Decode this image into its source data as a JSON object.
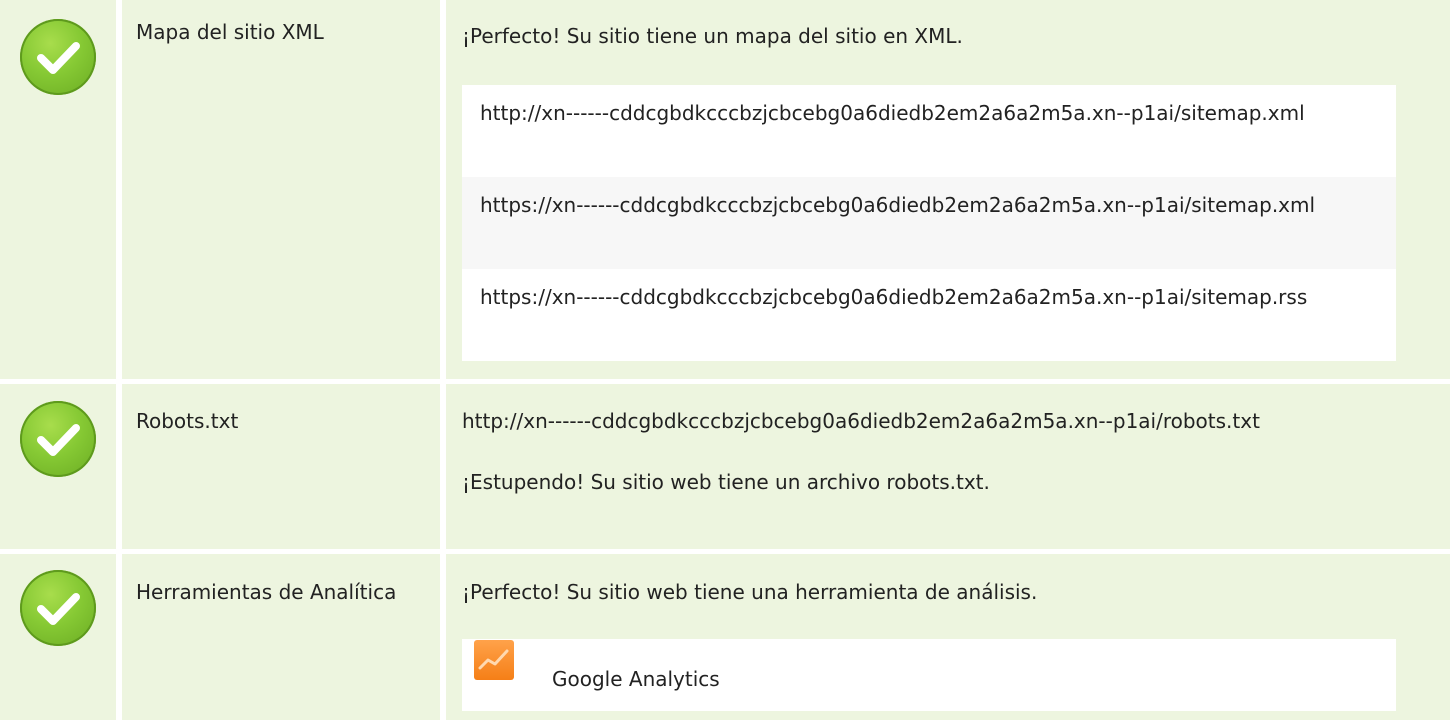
{
  "colors": {
    "cell_background": "#edf5df",
    "check_green": "#86c934",
    "analytics_orange": "#f57f17"
  },
  "rows": [
    {
      "status_icon": "check-circle-icon",
      "name": "Mapa del sitio XML",
      "message": "¡Perfecto! Su sitio tiene un mapa del sitio en XML.",
      "urls": [
        "http://xn------cddcgbdkcccbzjcbcebg0a6diedb2em2a6a2m5a.xn--p1ai/sitemap.xml",
        "https://xn------cddcgbdkcccbzjcbcebg0a6diedb2em2a6a2m5a.xn--p1ai/sitemap.xml",
        "https://xn------cddcgbdkcccbzjcbcebg0a6diedb2em2a6a2m5a.xn--p1ai/sitemap.rss"
      ]
    },
    {
      "status_icon": "check-circle-icon",
      "name": "Robots.txt",
      "url": "http://xn------cddcgbdkcccbzjcbcebg0a6diedb2em2a6a2m5a.xn--p1ai/robots.txt",
      "message": "¡Estupendo! Su sitio web tiene un archivo robots.txt."
    },
    {
      "status_icon": "check-circle-icon",
      "name": "Herramientas de Analítica",
      "message": "¡Perfecto! Su sitio web tiene una herramienta de análisis.",
      "tools": [
        {
          "icon": "google-analytics-icon",
          "name": "Google Analytics"
        }
      ]
    }
  ]
}
